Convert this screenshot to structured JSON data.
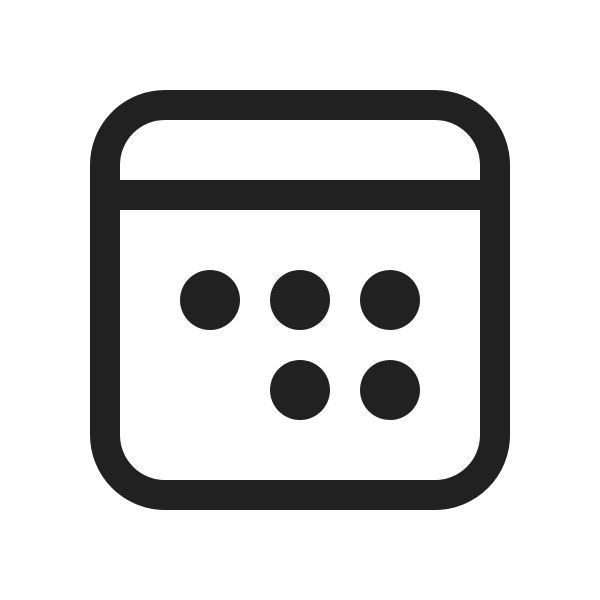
{
  "icon": {
    "name": "calendar-icon",
    "stroke_color": "#212121",
    "fill_color": "#212121",
    "background": "#ffffff",
    "grid_dots": {
      "row_1_count": 3,
      "row_2_count": 2
    }
  }
}
